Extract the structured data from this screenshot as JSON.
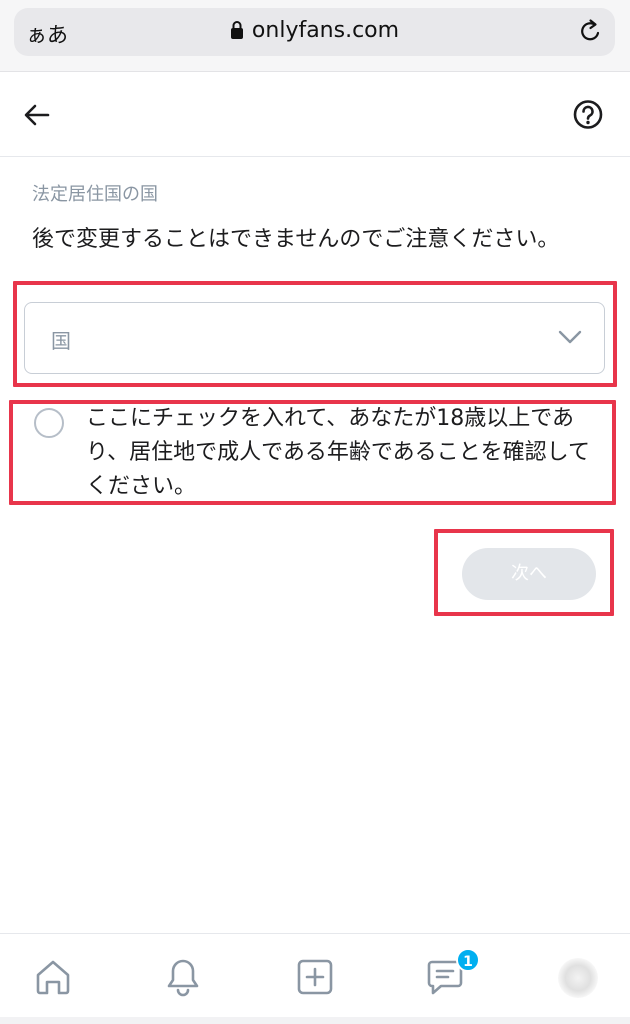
{
  "browser": {
    "text_size_label": "ぁあ",
    "url": "onlyfans.com"
  },
  "form": {
    "section_label": "法定居住国の国",
    "notice": "後で変更することはできませんのでご注意ください。",
    "country_select": {
      "placeholder": "国"
    },
    "age_confirm": {
      "checked": false,
      "label": "ここにチェックを入れて、あなたが18歳以上であり、居住地で成人である年齢であることを確認してください。"
    },
    "next_label": "次へ"
  },
  "bottom_nav": {
    "items": [
      {
        "icon": "home-icon"
      },
      {
        "icon": "bell-icon"
      },
      {
        "icon": "add-post-icon"
      },
      {
        "icon": "messages-icon"
      },
      {
        "icon": "avatar"
      }
    ],
    "messages_badge": "1"
  },
  "colors": {
    "highlight": "#e8354b",
    "badge": "#00aff0",
    "muted_text": "#8a96a3",
    "disabled_button": "#e3e6ea"
  }
}
